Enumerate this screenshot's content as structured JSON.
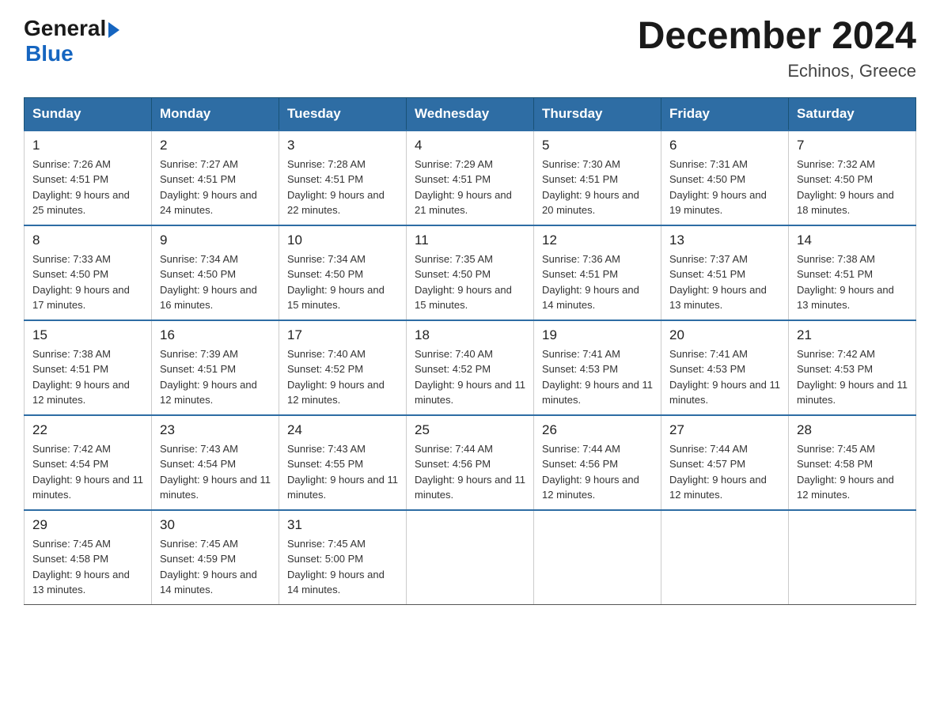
{
  "header": {
    "logo_general": "General",
    "logo_blue": "Blue",
    "month_title": "December 2024",
    "location": "Echinos, Greece"
  },
  "days_of_week": [
    "Sunday",
    "Monday",
    "Tuesday",
    "Wednesday",
    "Thursday",
    "Friday",
    "Saturday"
  ],
  "weeks": [
    [
      {
        "day": "1",
        "sunrise": "7:26 AM",
        "sunset": "4:51 PM",
        "daylight": "9 hours and 25 minutes."
      },
      {
        "day": "2",
        "sunrise": "7:27 AM",
        "sunset": "4:51 PM",
        "daylight": "9 hours and 24 minutes."
      },
      {
        "day": "3",
        "sunrise": "7:28 AM",
        "sunset": "4:51 PM",
        "daylight": "9 hours and 22 minutes."
      },
      {
        "day": "4",
        "sunrise": "7:29 AM",
        "sunset": "4:51 PM",
        "daylight": "9 hours and 21 minutes."
      },
      {
        "day": "5",
        "sunrise": "7:30 AM",
        "sunset": "4:51 PM",
        "daylight": "9 hours and 20 minutes."
      },
      {
        "day": "6",
        "sunrise": "7:31 AM",
        "sunset": "4:50 PM",
        "daylight": "9 hours and 19 minutes."
      },
      {
        "day": "7",
        "sunrise": "7:32 AM",
        "sunset": "4:50 PM",
        "daylight": "9 hours and 18 minutes."
      }
    ],
    [
      {
        "day": "8",
        "sunrise": "7:33 AM",
        "sunset": "4:50 PM",
        "daylight": "9 hours and 17 minutes."
      },
      {
        "day": "9",
        "sunrise": "7:34 AM",
        "sunset": "4:50 PM",
        "daylight": "9 hours and 16 minutes."
      },
      {
        "day": "10",
        "sunrise": "7:34 AM",
        "sunset": "4:50 PM",
        "daylight": "9 hours and 15 minutes."
      },
      {
        "day": "11",
        "sunrise": "7:35 AM",
        "sunset": "4:50 PM",
        "daylight": "9 hours and 15 minutes."
      },
      {
        "day": "12",
        "sunrise": "7:36 AM",
        "sunset": "4:51 PM",
        "daylight": "9 hours and 14 minutes."
      },
      {
        "day": "13",
        "sunrise": "7:37 AM",
        "sunset": "4:51 PM",
        "daylight": "9 hours and 13 minutes."
      },
      {
        "day": "14",
        "sunrise": "7:38 AM",
        "sunset": "4:51 PM",
        "daylight": "9 hours and 13 minutes."
      }
    ],
    [
      {
        "day": "15",
        "sunrise": "7:38 AM",
        "sunset": "4:51 PM",
        "daylight": "9 hours and 12 minutes."
      },
      {
        "day": "16",
        "sunrise": "7:39 AM",
        "sunset": "4:51 PM",
        "daylight": "9 hours and 12 minutes."
      },
      {
        "day": "17",
        "sunrise": "7:40 AM",
        "sunset": "4:52 PM",
        "daylight": "9 hours and 12 minutes."
      },
      {
        "day": "18",
        "sunrise": "7:40 AM",
        "sunset": "4:52 PM",
        "daylight": "9 hours and 11 minutes."
      },
      {
        "day": "19",
        "sunrise": "7:41 AM",
        "sunset": "4:53 PM",
        "daylight": "9 hours and 11 minutes."
      },
      {
        "day": "20",
        "sunrise": "7:41 AM",
        "sunset": "4:53 PM",
        "daylight": "9 hours and 11 minutes."
      },
      {
        "day": "21",
        "sunrise": "7:42 AM",
        "sunset": "4:53 PM",
        "daylight": "9 hours and 11 minutes."
      }
    ],
    [
      {
        "day": "22",
        "sunrise": "7:42 AM",
        "sunset": "4:54 PM",
        "daylight": "9 hours and 11 minutes."
      },
      {
        "day": "23",
        "sunrise": "7:43 AM",
        "sunset": "4:54 PM",
        "daylight": "9 hours and 11 minutes."
      },
      {
        "day": "24",
        "sunrise": "7:43 AM",
        "sunset": "4:55 PM",
        "daylight": "9 hours and 11 minutes."
      },
      {
        "day": "25",
        "sunrise": "7:44 AM",
        "sunset": "4:56 PM",
        "daylight": "9 hours and 11 minutes."
      },
      {
        "day": "26",
        "sunrise": "7:44 AM",
        "sunset": "4:56 PM",
        "daylight": "9 hours and 12 minutes."
      },
      {
        "day": "27",
        "sunrise": "7:44 AM",
        "sunset": "4:57 PM",
        "daylight": "9 hours and 12 minutes."
      },
      {
        "day": "28",
        "sunrise": "7:45 AM",
        "sunset": "4:58 PM",
        "daylight": "9 hours and 12 minutes."
      }
    ],
    [
      {
        "day": "29",
        "sunrise": "7:45 AM",
        "sunset": "4:58 PM",
        "daylight": "9 hours and 13 minutes."
      },
      {
        "day": "30",
        "sunrise": "7:45 AM",
        "sunset": "4:59 PM",
        "daylight": "9 hours and 14 minutes."
      },
      {
        "day": "31",
        "sunrise": "7:45 AM",
        "sunset": "5:00 PM",
        "daylight": "9 hours and 14 minutes."
      },
      null,
      null,
      null,
      null
    ]
  ]
}
